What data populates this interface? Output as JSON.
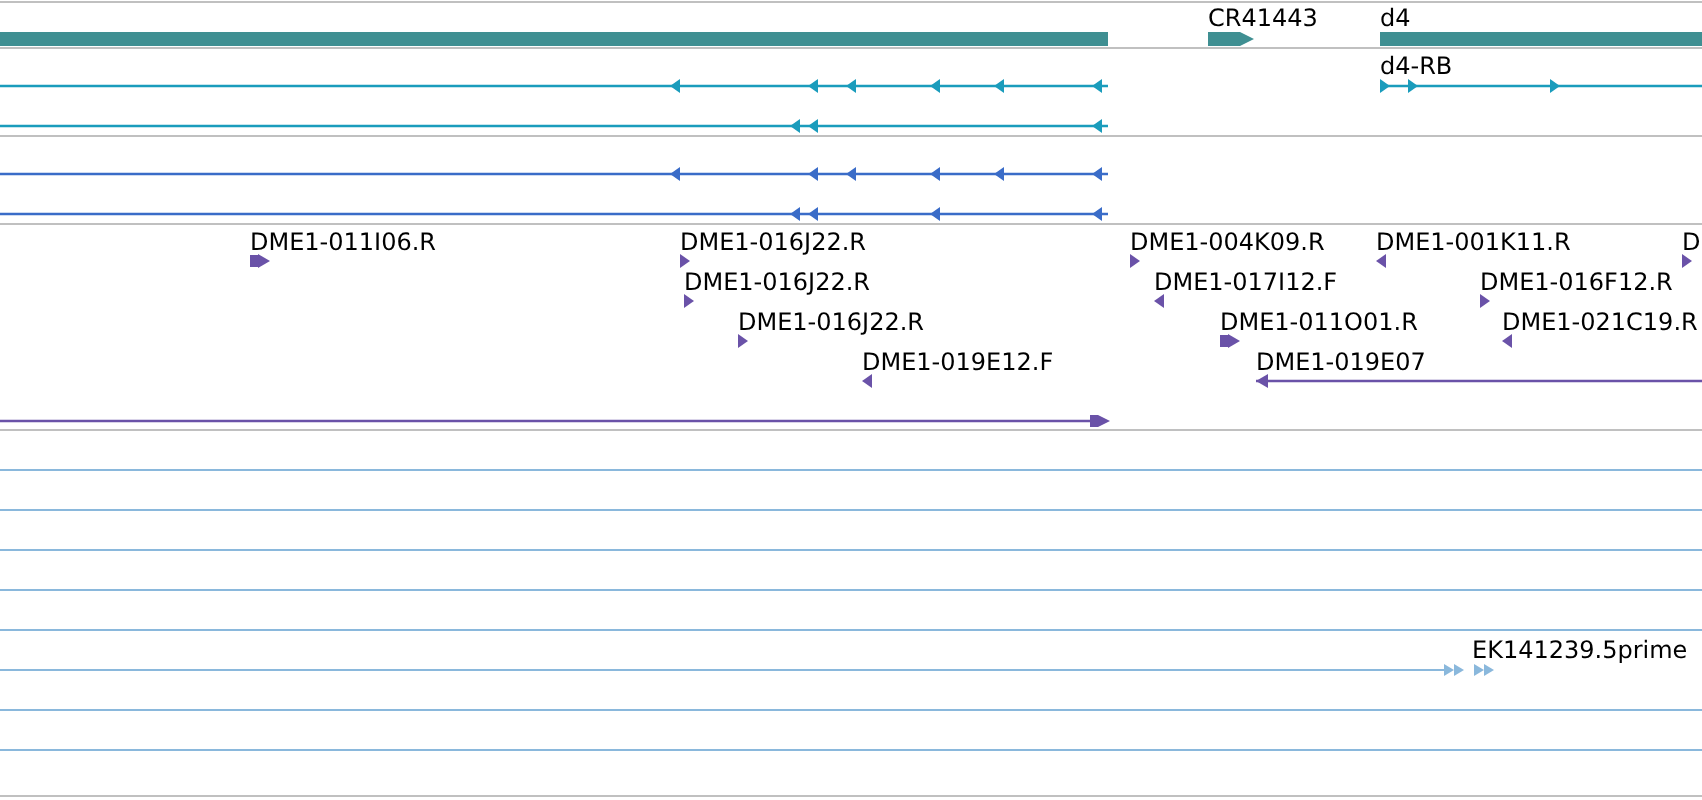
{
  "gene_track": {
    "features": [
      {
        "kind": "bar"
      },
      {
        "kind": "bar",
        "label": "CR41443",
        "reverse": false
      },
      {
        "kind": "bar",
        "label": "d4"
      }
    ]
  },
  "transcript_tracks": [
    {
      "transcripts": [
        {
          "reverse": true
        },
        {
          "reverse": true
        },
        {
          "reverse": false,
          "label": "d4-RB"
        }
      ]
    },
    {
      "transcripts": [
        {
          "reverse": true
        },
        {
          "reverse": true
        }
      ]
    }
  ],
  "est_track": {
    "features": [
      {
        "label": "DME1-011I06.R",
        "reverse": false
      },
      {
        "label": "DME1-016J22.R",
        "reverse": false
      },
      {
        "label": "DME1-004K09.R",
        "reverse": false
      },
      {
        "label": "DME1-001K11.R",
        "reverse": true
      },
      {
        "label": "D",
        "reverse": false
      },
      {
        "label": "DME1-016J22.R",
        "reverse": false
      },
      {
        "label": "DME1-017I12.F",
        "reverse": true
      },
      {
        "label": "DME1-016F12.R",
        "reverse": false
      },
      {
        "label": "DME1-016J22.R",
        "reverse": false
      },
      {
        "label": "DME1-011O01.R",
        "reverse": false
      },
      {
        "label": "DME1-021C19.R",
        "reverse": true
      },
      {
        "label": "DME1-019E12.F",
        "reverse": true
      },
      {
        "label": "DME1-019E07",
        "reverse": true
      },
      {
        "reverse": false
      }
    ]
  },
  "read_track": {
    "features": [
      {
        "label": "EK141239.5prime",
        "reverse": false
      }
    ]
  }
}
